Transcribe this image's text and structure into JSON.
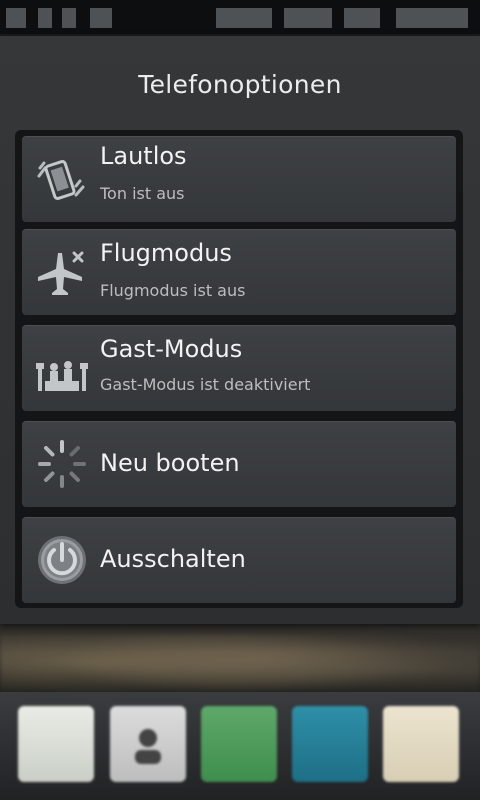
{
  "dialog": {
    "title": "Telefonoptionen",
    "options": [
      {
        "title": "Lautlos",
        "subtitle": "Ton ist aus",
        "icon": "silent-phone-icon"
      },
      {
        "title": "Flugmodus",
        "subtitle": "Flugmodus ist aus",
        "icon": "airplane-icon"
      },
      {
        "title": "Gast-Modus",
        "subtitle": "Gast-Modus ist deaktiviert",
        "icon": "guest-mode-icon"
      },
      {
        "title": "Neu booten",
        "subtitle": "",
        "icon": "reboot-spinner-icon"
      },
      {
        "title": "Ausschalten",
        "subtitle": "",
        "icon": "power-icon"
      }
    ]
  },
  "colors": {
    "dialog_bg": "#2f3133",
    "option_bg": "#3a3d40",
    "text_primary": "#f2f2f2",
    "text_secondary": "#bdbdbd"
  }
}
